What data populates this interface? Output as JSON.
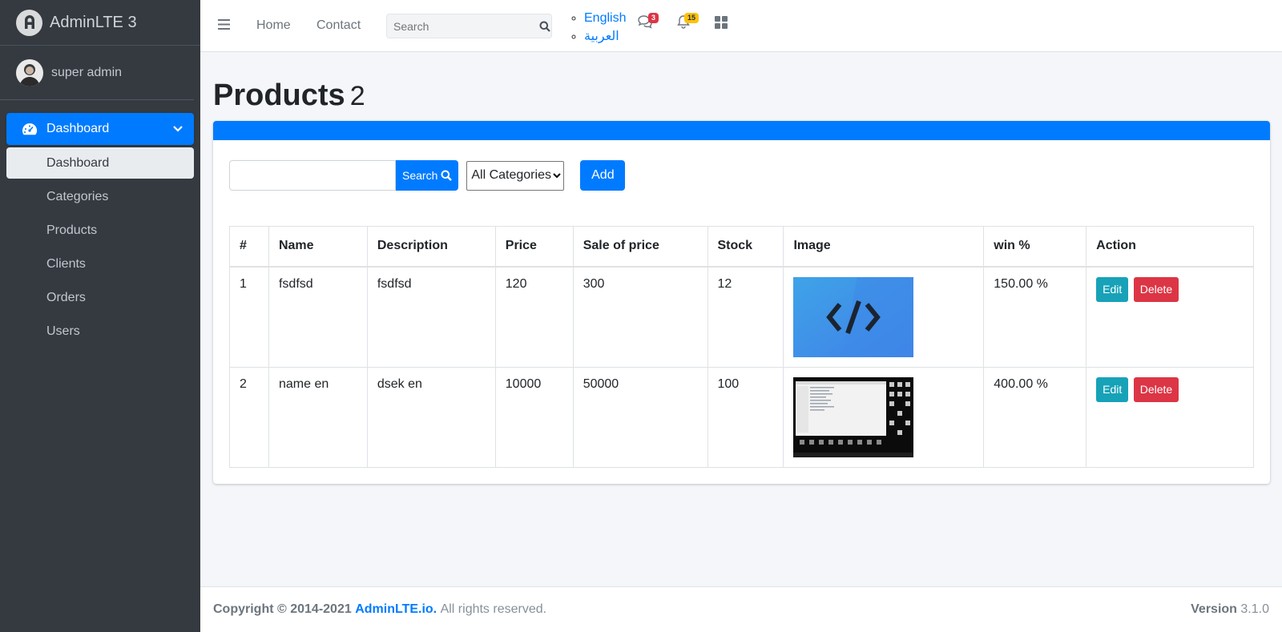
{
  "brand": {
    "name": "AdminLTE 3"
  },
  "user": {
    "name": "super admin"
  },
  "sidebar": {
    "main": "Dashboard",
    "items": [
      {
        "label": "Dashboard",
        "active": true
      },
      {
        "label": "Categories"
      },
      {
        "label": "Products"
      },
      {
        "label": "Clients"
      },
      {
        "label": "Orders"
      },
      {
        "label": "Users"
      }
    ]
  },
  "topbar": {
    "home": "Home",
    "contact": "Contact",
    "search_placeholder": "Search",
    "languages": [
      "English",
      "العربية"
    ],
    "messages_badge": "3",
    "notifications_badge": "15"
  },
  "page": {
    "title": "Products",
    "count": "2"
  },
  "filters": {
    "search_button": "Search",
    "category_selected": "All Categories",
    "add_button": "Add"
  },
  "table": {
    "headers": [
      "#",
      "Name",
      "Description",
      "Price",
      "Sale of price",
      "Stock",
      "Image",
      "win %",
      "Action"
    ],
    "rows": [
      {
        "index": "1",
        "name": "fsdfsd",
        "description": "fsdfsd",
        "price": "120",
        "sale_price": "300",
        "stock": "12",
        "win": "150.00 %",
        "image": "code-icon-image"
      },
      {
        "index": "2",
        "name": "name en",
        "description": "dsek en",
        "price": "10000",
        "sale_price": "50000",
        "stock": "100",
        "win": "400.00 %",
        "image": "desktop-screenshot-image"
      }
    ],
    "edit_label": "Edit",
    "delete_label": "Delete"
  },
  "footer": {
    "copyright": "Copyright © 2014-2021",
    "link": "AdminLTE.io.",
    "rights": "All rights reserved.",
    "version_label": "Version",
    "version": "3.1.0"
  },
  "colors": {
    "primary": "#007bff",
    "sidebar": "#343a40",
    "info": "#17a2b8",
    "danger": "#dc3545",
    "warning": "#ffc107"
  }
}
